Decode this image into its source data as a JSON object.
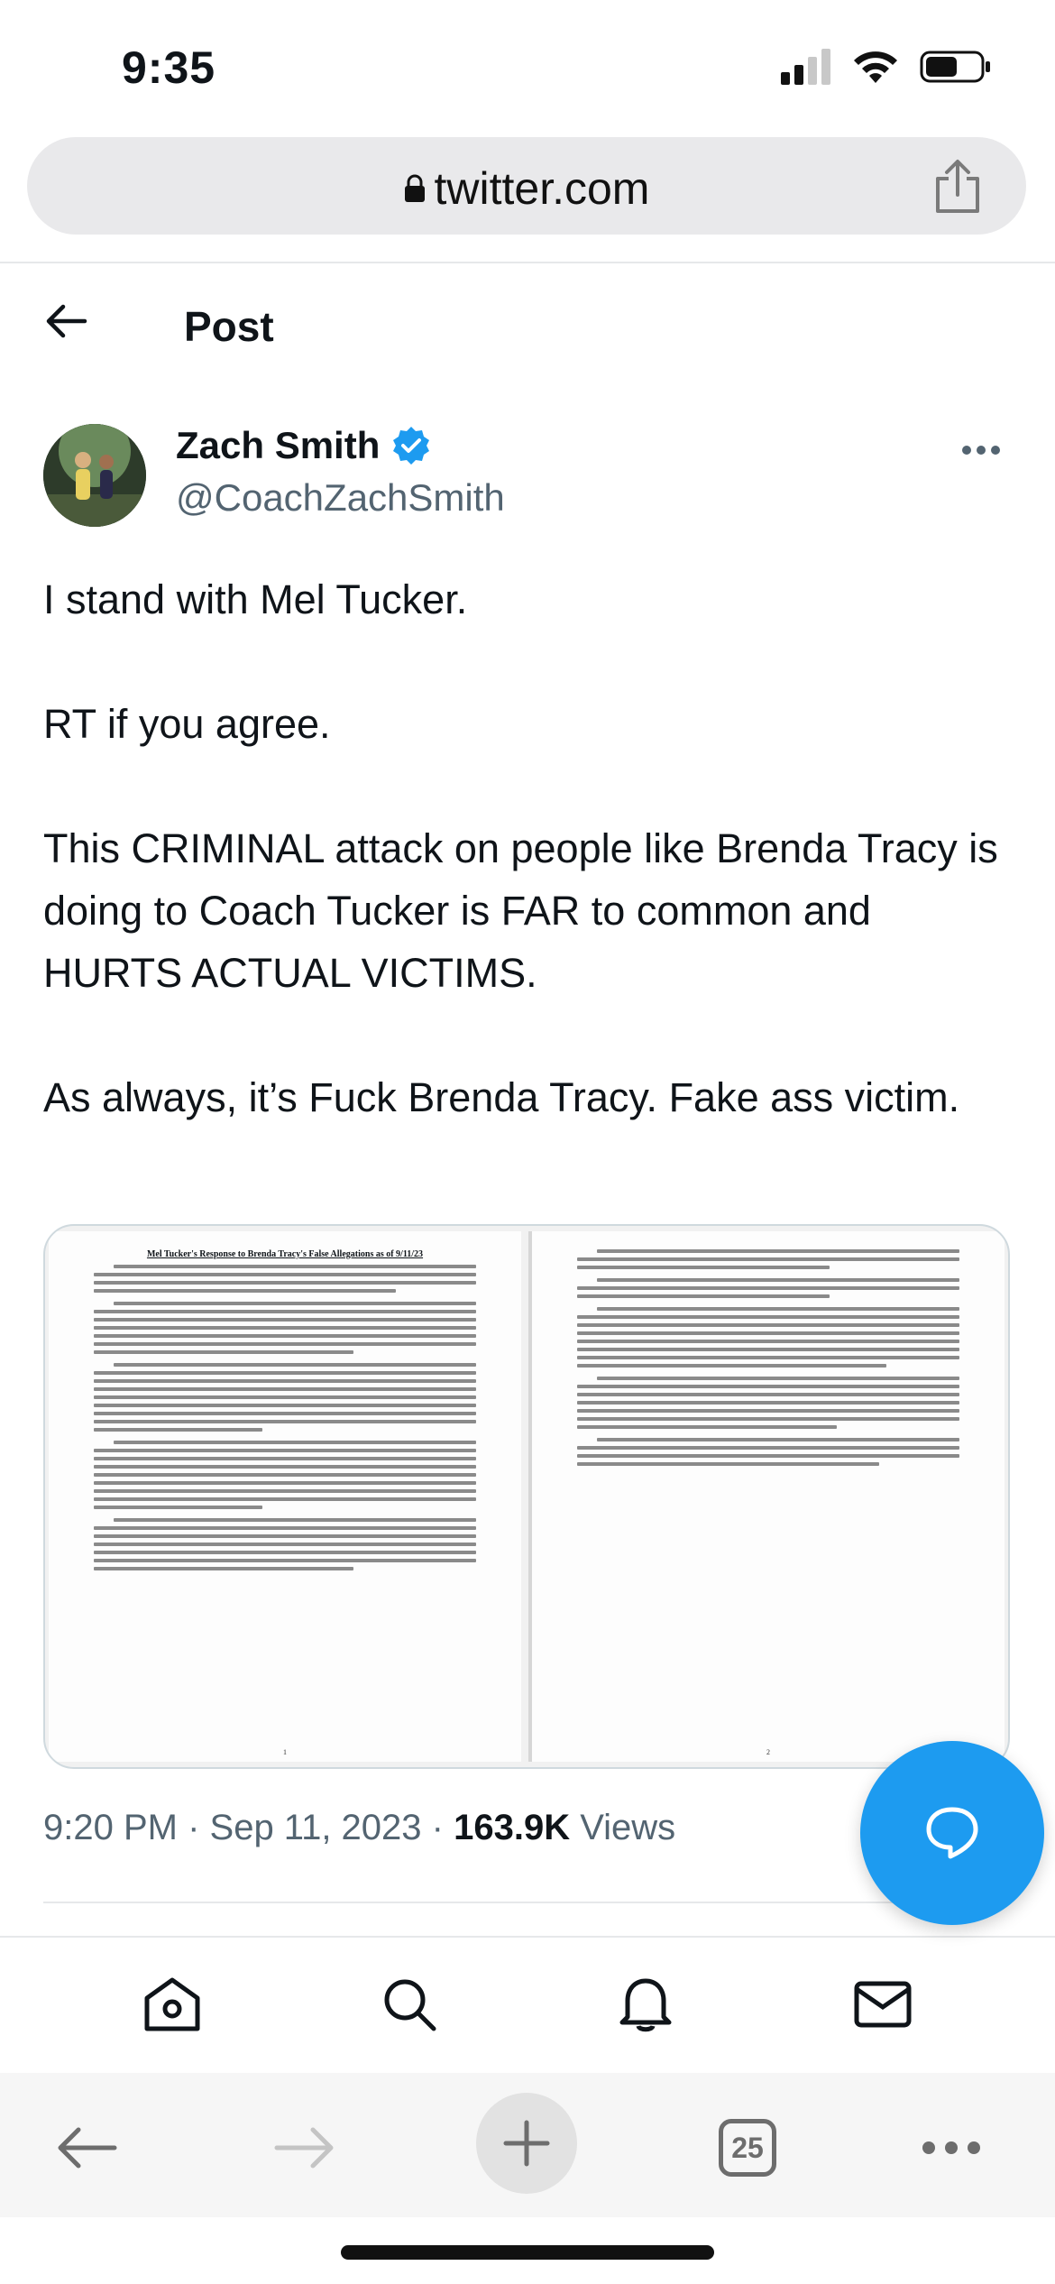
{
  "status_bar": {
    "time": "9:35"
  },
  "browser": {
    "url": "twitter.com",
    "tabs_count": "25"
  },
  "header": {
    "title": "Post"
  },
  "post": {
    "author_name": "Zach Smith",
    "author_handle": "@CoachZachSmith",
    "paragraphs": [
      "I stand with Mel Tucker.",
      "RT if you agree.",
      "This CRIMINAL attack on people like Brenda Tracy is doing to Coach Tucker is FAR to common and HURTS ACTUAL VICTIMS.",
      "As always, it’s Fuck Brenda Tracy.  Fake ass victim."
    ],
    "media": {
      "page1_heading": "Mel Tucker's Response to Brenda Tracy's False Allegations as of 9/11/23",
      "page1_number": "1",
      "page2_number": "2"
    },
    "time": "9:20 PM",
    "date": "Sep 11, 2023",
    "views_count": "163.9K",
    "views_label": "Views"
  },
  "icons": {
    "verified": "verified-badge-icon",
    "accent": "#1d9bf0"
  }
}
